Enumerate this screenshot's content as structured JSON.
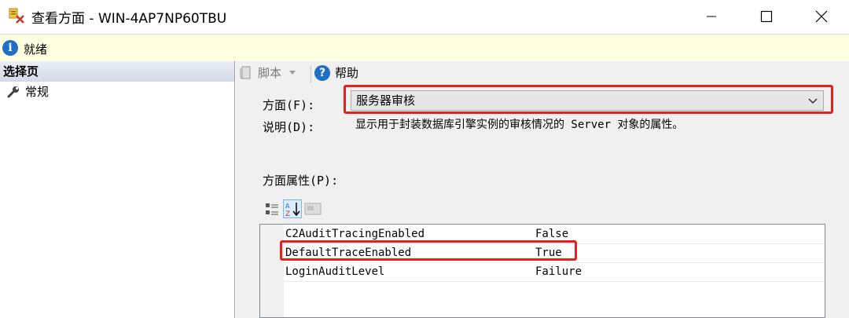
{
  "window": {
    "title": "查看方面 - WIN-4AP7NP60TBU"
  },
  "info_bar": {
    "status": "就绪"
  },
  "left_pane": {
    "header": "选择页",
    "items": [
      {
        "label": "常规"
      }
    ]
  },
  "toolbar": {
    "script_label": "脚本",
    "help_label": "帮助"
  },
  "facet": {
    "label": "方面(F):",
    "selected": "服务器审核"
  },
  "description": {
    "label": "说明(D):",
    "text": "显示用于封装数据库引擎实例的审核情况的 Server 对象的属性。"
  },
  "properties": {
    "label": "方面属性(P):",
    "rows": [
      {
        "name": "C2AuditTracingEnabled",
        "value": "False"
      },
      {
        "name": "DefaultTraceEnabled",
        "value": "True"
      },
      {
        "name": "LoginAuditLevel",
        "value": "Failure"
      }
    ]
  },
  "colors": {
    "highlight": "#e8201c",
    "info_background": "#ffffe1",
    "accent": "#1f6fc5"
  },
  "icons": [
    "facet-app-icon",
    "minimize-icon",
    "maximize-icon",
    "close-icon",
    "info-icon",
    "wrench-icon",
    "script-icon",
    "help-icon",
    "categorized-icon",
    "sort-alpha-icon",
    "property-pages-icon",
    "chevron-down-icon"
  ]
}
